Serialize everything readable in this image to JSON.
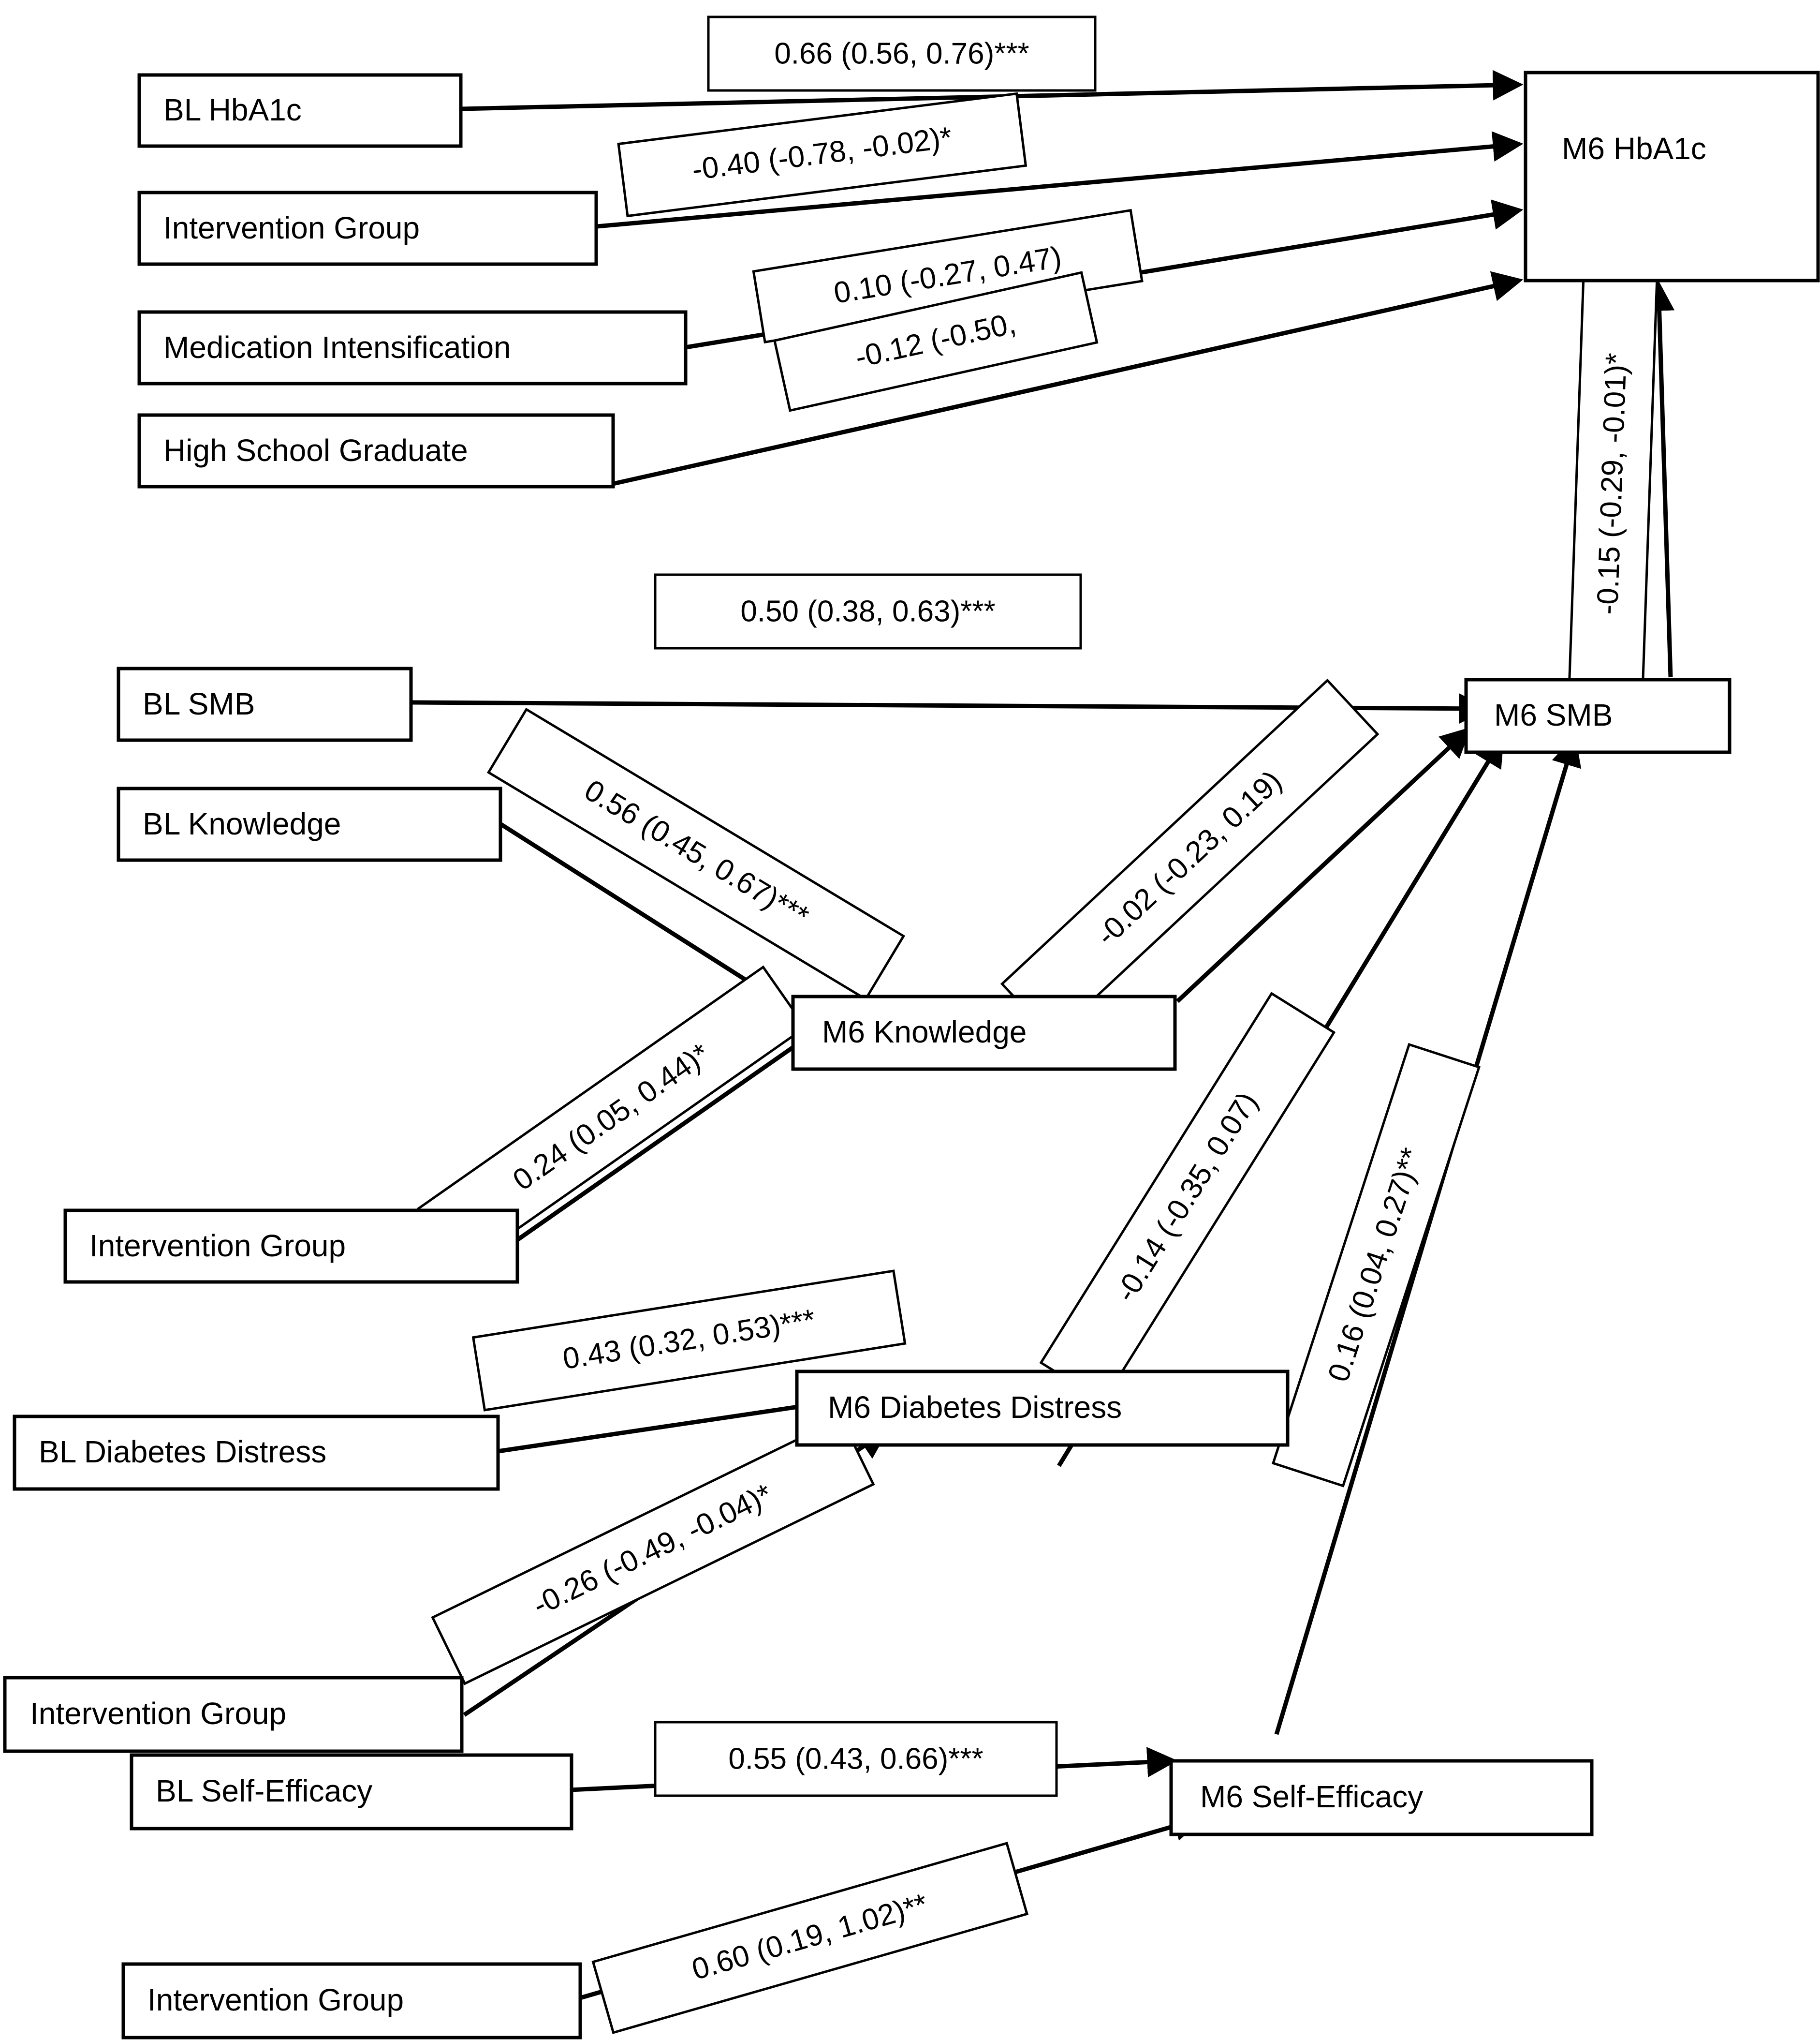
{
  "figure": {
    "type": "path-diagram",
    "description": "Structural equation / path model diagram of baseline (BL) and 6-month (M6) diabetes outcomes",
    "significance_legend": {
      "p05": "*",
      "p01": "**",
      "p001": "***"
    },
    "colors": {
      "stroke": "#000000",
      "fill": "#ffffff"
    }
  },
  "nodes": {
    "bl_hba1c": {
      "label": "BL HbA1c"
    },
    "intervention_group_1": {
      "label": "Intervention Group"
    },
    "medication_intensification": {
      "label": "Medication Intensification"
    },
    "high_school_graduate": {
      "label": "High School Graduate"
    },
    "m6_hba1c": {
      "label": "M6 HbA1c"
    },
    "bl_smb": {
      "label": "BL SMB"
    },
    "bl_knowledge": {
      "label": "BL Knowledge"
    },
    "m6_smb": {
      "label": "M6 SMB"
    },
    "m6_knowledge": {
      "label": "M6 Knowledge"
    },
    "intervention_group_2": {
      "label": "Intervention Group"
    },
    "bl_diabetes_distress": {
      "label": "BL Diabetes Distress"
    },
    "m6_diabetes_distress": {
      "label": "M6 Diabetes Distress"
    },
    "intervention_group_3": {
      "label": "Intervention Group"
    },
    "bl_self_efficacy": {
      "label": "BL Self-Efficacy"
    },
    "m6_self_efficacy": {
      "label": "M6 Self-Efficacy"
    },
    "intervention_group_4": {
      "label": "Intervention Group"
    }
  },
  "edges": [
    {
      "id": "e1",
      "from": "bl_hba1c",
      "to": "m6_hba1c",
      "label": "0.66 (0.56, 0.76)***",
      "estimate": 0.66,
      "ci": [
        0.56,
        0.76
      ],
      "sig": "***"
    },
    {
      "id": "e2",
      "from": "intervention_group_1",
      "to": "m6_hba1c",
      "label": "-0.40 (-0.78, -0.02)*",
      "estimate": -0.4,
      "ci": [
        -0.78,
        -0.02
      ],
      "sig": "*"
    },
    {
      "id": "e3",
      "from": "medication_intensification",
      "to": "m6_hba1c",
      "label": "0.10 (-0.27, 0.47)",
      "estimate": 0.1,
      "ci": [
        -0.27,
        0.47
      ],
      "sig": ""
    },
    {
      "id": "e4",
      "from": "high_school_graduate",
      "to": "m6_hba1c",
      "label": "-0.12 (-0.50,",
      "estimate": -0.12,
      "ci": [
        -0.5,
        null
      ],
      "sig": "",
      "truncated": true
    },
    {
      "id": "e5",
      "from": "m6_smb",
      "to": "m6_hba1c",
      "label": "-0.15 (-0.29, -0.01)*",
      "estimate": -0.15,
      "ci": [
        -0.29,
        -0.01
      ],
      "sig": "*"
    },
    {
      "id": "e6",
      "from": "bl_smb",
      "to": "m6_smb",
      "label": "0.50 (0.38, 0.63)***",
      "estimate": 0.5,
      "ci": [
        0.38,
        0.63
      ],
      "sig": "***"
    },
    {
      "id": "e7",
      "from": "bl_knowledge",
      "to": "m6_knowledge",
      "label": "0.56 (0.45, 0.67)***",
      "estimate": 0.56,
      "ci": [
        0.45,
        0.67
      ],
      "sig": "***"
    },
    {
      "id": "e8",
      "from": "m6_knowledge",
      "to": "m6_smb",
      "label": "-0.02 (-0.23, 0.19)",
      "estimate": -0.02,
      "ci": [
        -0.23,
        0.19
      ],
      "sig": ""
    },
    {
      "id": "e9",
      "from": "intervention_group_2",
      "to": "m6_knowledge",
      "label": "0.24 (0.05, 0.44)*",
      "estimate": 0.24,
      "ci": [
        0.05,
        0.44
      ],
      "sig": "*"
    },
    {
      "id": "e10",
      "from": "m6_diabetes_distress",
      "to": "m6_smb",
      "label": "-0.14 (-0.35, 0.07)",
      "estimate": -0.14,
      "ci": [
        -0.35,
        0.07
      ],
      "sig": ""
    },
    {
      "id": "e11",
      "from": "m6_self_efficacy",
      "to": "m6_smb",
      "label": "0.16 (0.04, 0.27)**",
      "estimate": 0.16,
      "ci": [
        0.04,
        0.27
      ],
      "sig": "**"
    },
    {
      "id": "e12",
      "from": "bl_diabetes_distress",
      "to": "m6_diabetes_distress",
      "label": "0.43 (0.32, 0.53)***",
      "estimate": 0.43,
      "ci": [
        0.32,
        0.53
      ],
      "sig": "***"
    },
    {
      "id": "e13",
      "from": "intervention_group_3",
      "to": "m6_diabetes_distress",
      "label": "-0.26 (-0.49, -0.04)*",
      "estimate": -0.26,
      "ci": [
        -0.49,
        -0.04
      ],
      "sig": "*"
    },
    {
      "id": "e14",
      "from": "bl_self_efficacy",
      "to": "m6_self_efficacy",
      "label": "0.55 (0.43, 0.66)***",
      "estimate": 0.55,
      "ci": [
        0.43,
        0.66
      ],
      "sig": "***"
    },
    {
      "id": "e15",
      "from": "intervention_group_4",
      "to": "m6_self_efficacy",
      "label": "0.60 (0.19, 1.02)**",
      "estimate": 0.6,
      "ci": [
        0.19,
        1.02
      ],
      "sig": "**"
    }
  ]
}
